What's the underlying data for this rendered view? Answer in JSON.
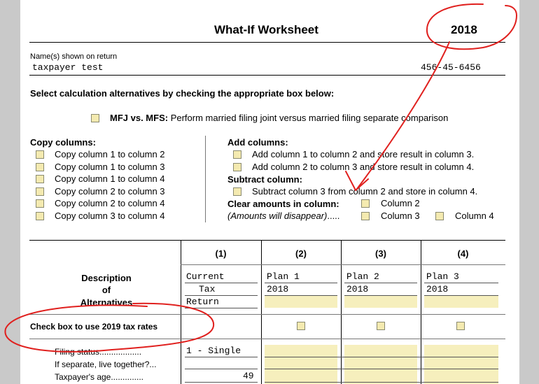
{
  "header": {
    "title": "What-If Worksheet",
    "year": "2018"
  },
  "name_section": {
    "label": "Name(s) shown on return",
    "name": "taxpayer test",
    "ssn": "456-45-6456"
  },
  "instruction": "Select calculation alternatives by checking the appropriate box below:",
  "mfj": {
    "bold_label": "MFJ vs. MFS:",
    "text": "Perform married filing joint versus married filing separate comparison"
  },
  "copy_columns": {
    "heading": "Copy columns:",
    "items": [
      "Copy column 1 to column 2",
      "Copy column 1 to column 3",
      "Copy column 1 to column 4",
      "Copy column 2 to column 3",
      "Copy column 2 to column 4",
      "Copy column 3 to column 4"
    ]
  },
  "add_columns": {
    "heading": "Add columns:",
    "items": [
      "Add column 1 to column 2 and store result in column 3.",
      "Add column 2 to column 3 and store result in column 4."
    ]
  },
  "subtract_column": {
    "heading": "Subtract column:",
    "item": "Subtract column 3 from column 2 and store in column 4."
  },
  "clear_amounts": {
    "heading": "Clear amounts in column:",
    "note": "(Amounts will disappear)",
    "dots": ".....",
    "col2": "Column 2",
    "col3": "Column 3",
    "col4": "Column 4"
  },
  "table": {
    "desc_lines": [
      "Description",
      "of",
      "Alternatives"
    ],
    "col_numbers": [
      "(1)",
      "(2)",
      "(3)",
      "(4)"
    ],
    "col1_lines": [
      "Current",
      "Tax",
      "Return"
    ],
    "plans": [
      {
        "name": "Plan 1",
        "year": "2018"
      },
      {
        "name": "Plan 2",
        "year": "2018"
      },
      {
        "name": "Plan 3",
        "year": "2018"
      }
    ],
    "check_2019": "Check box to use 2019 tax rates",
    "rows": [
      {
        "label": "Filing status",
        "dots": "..................",
        "col1": "1 - Single"
      },
      {
        "label": "If separate, live together?",
        "dots": "...",
        "col1": ""
      },
      {
        "label": "Taxpayer's age",
        "dots": "..............",
        "col1": "49"
      }
    ]
  },
  "annotation_color": "#e0201e"
}
